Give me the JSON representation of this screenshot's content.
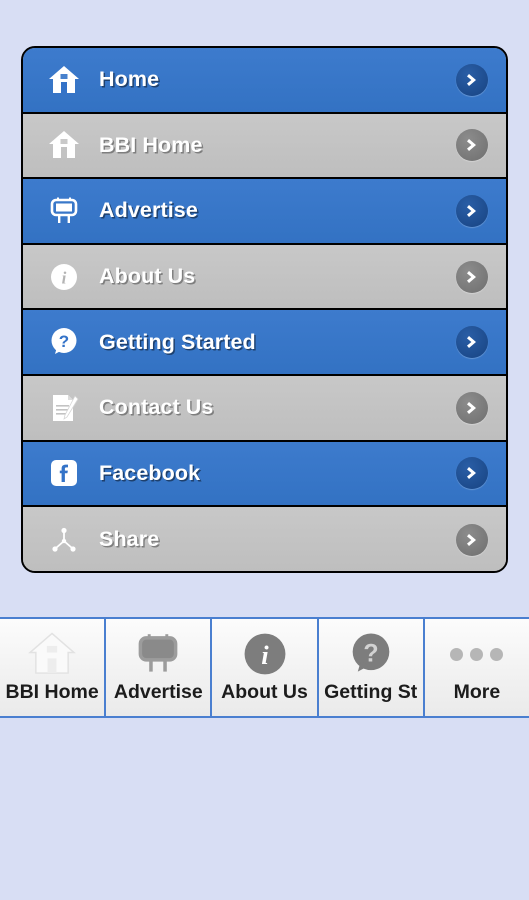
{
  "theme": {
    "page_background": "#d8def4",
    "accent_blue": "#3473c8",
    "row_gray": "#c3c3c3",
    "arrow_blue": "#1e4f92",
    "arrow_gray": "#7e7e7e",
    "tab_separator": "#4a7fd0",
    "label_color": "#ffffff",
    "tab_label_color": "#1c1c1c"
  },
  "menu": {
    "rows": [
      {
        "label": "Home",
        "icon": "home-icon",
        "style": "blue",
        "arrow": "chevron-right-icon"
      },
      {
        "label": "BBI Home",
        "icon": "home-icon",
        "style": "gray",
        "arrow": "chevron-right-icon"
      },
      {
        "label": "Advertise",
        "icon": "billboard-icon",
        "style": "blue",
        "arrow": "chevron-right-icon"
      },
      {
        "label": "About Us",
        "icon": "info-circle-icon",
        "style": "gray",
        "arrow": "chevron-right-icon"
      },
      {
        "label": "Getting Started",
        "icon": "question-bubble-icon",
        "style": "blue",
        "arrow": "chevron-right-icon"
      },
      {
        "label": "Contact Us",
        "icon": "document-pencil-icon",
        "style": "gray",
        "arrow": "chevron-right-icon"
      },
      {
        "label": "Facebook",
        "icon": "facebook-icon",
        "style": "blue",
        "arrow": "chevron-right-icon"
      },
      {
        "label": "Share",
        "icon": "share-node-icon",
        "style": "gray",
        "arrow": "chevron-right-icon"
      }
    ]
  },
  "tabbar": {
    "tabs": [
      {
        "label": "BBI Home",
        "icon": "home-icon"
      },
      {
        "label": "Advertise",
        "icon": "billboard-icon"
      },
      {
        "label": "About Us",
        "icon": "info-circle-icon"
      },
      {
        "label": "Getting St",
        "icon": "question-bubble-icon"
      },
      {
        "label": "More",
        "icon": "ellipsis-icon"
      }
    ]
  }
}
